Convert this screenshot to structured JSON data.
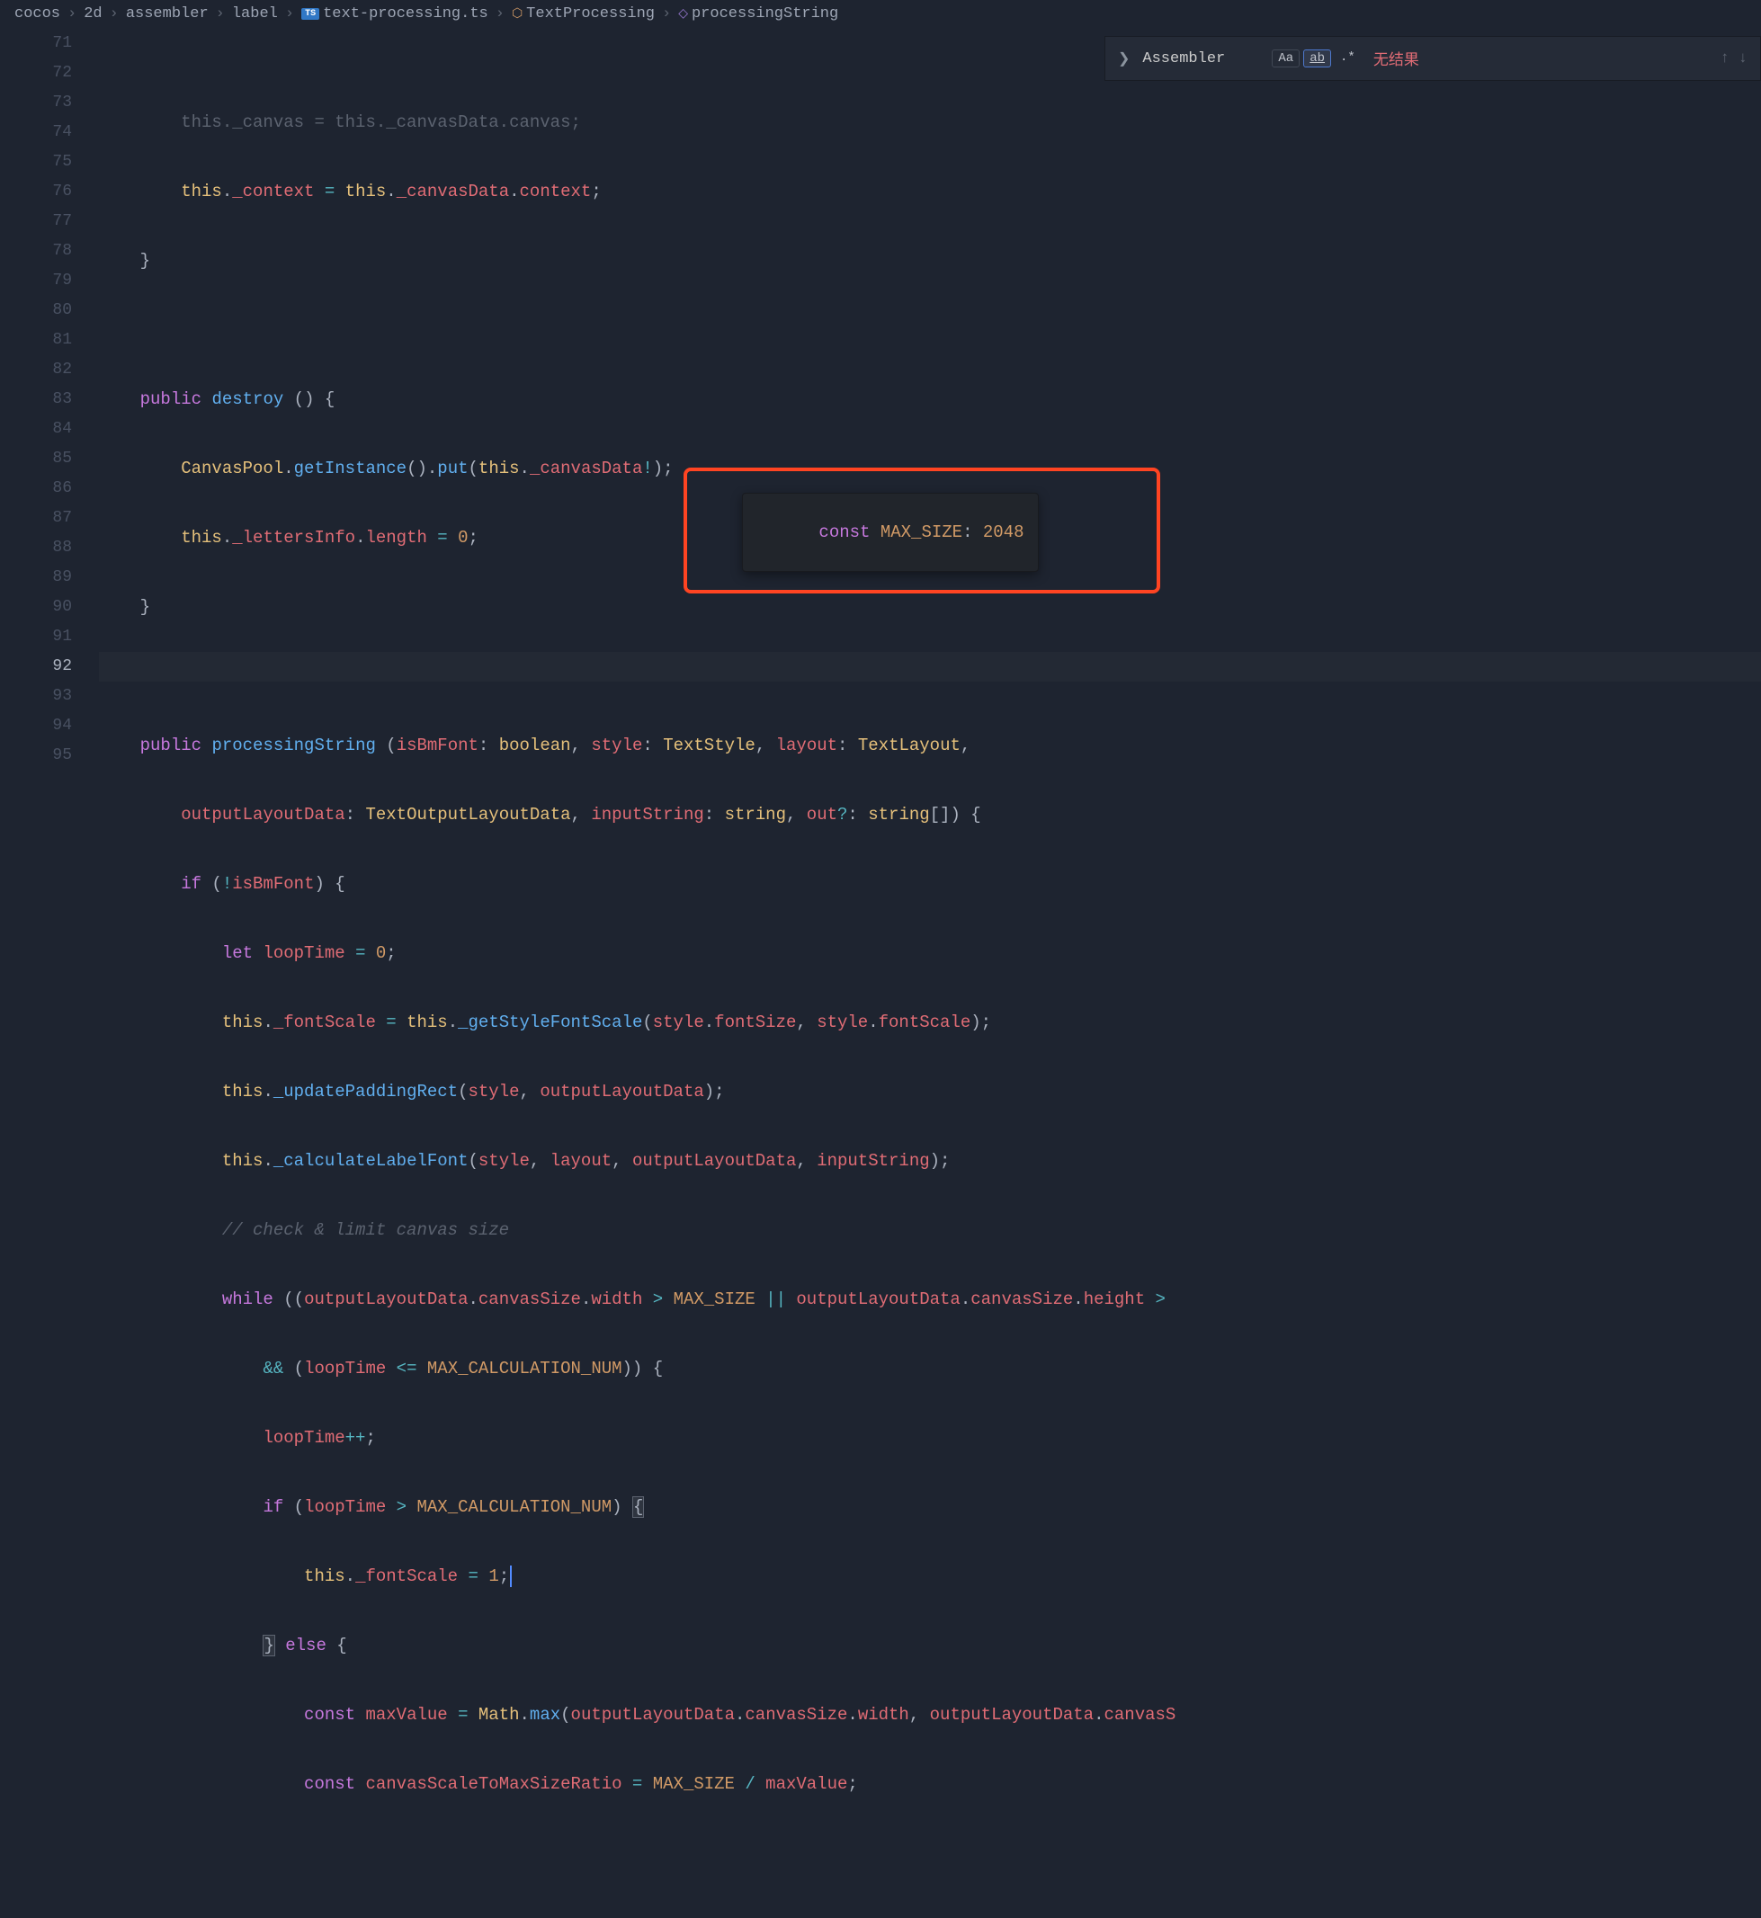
{
  "breadcrumb": {
    "parts": [
      "cocos",
      "2d",
      "assembler",
      "label",
      "text-processing.ts",
      "TextProcessing",
      "processingString"
    ]
  },
  "find": {
    "chevron": "❯",
    "text": "Assembler",
    "case_btn": "Aa",
    "word_btn": "ab",
    "regex_btn": ".*",
    "no_result": "无结果",
    "up": "↑",
    "down": "↓"
  },
  "gutter": {
    "start": 71,
    "end": 95
  },
  "tooltip": {
    "prefix": "const ",
    "name": "MAX_SIZE",
    "sep": ": ",
    "value": "2048"
  },
  "code_lines": {
    "l71": "        this._canvas = this._canvasData.canvas;",
    "l72_a": "        ",
    "l72_this": "this",
    "l72_dot1": ".",
    "l72_ctx": "_context",
    "l72_eq": " = ",
    "l72_this2": "this",
    "l72_dot2": ".",
    "l72_cd": "_canvasData",
    "l72_dot3": ".",
    "l72_c": "context",
    "l72_semi": ";",
    "l73": "    }",
    "l74": "",
    "l75_a": "    ",
    "l75_pub": "public",
    "l75_sp": " ",
    "l75_fn": "destroy",
    "l75_b": " () {",
    "l76_a": "        ",
    "l76_cp": "CanvasPool",
    "l76_d": ".",
    "l76_gi": "getInstance",
    "l76_p": "().",
    "l76_put": "put",
    "l76_op": "(",
    "l76_this": "this",
    "l76_d2": ".",
    "l76_cd": "_canvasData",
    "l76_ex": "!",
    "l76_cl": ");",
    "l77_a": "        ",
    "l77_this": "this",
    "l77_d": ".",
    "l77_li": "_lettersInfo",
    "l77_d2": ".",
    "l77_len": "length",
    "l77_eq": " = ",
    "l77_z": "0",
    "l77_s": ";",
    "l78": "    }",
    "l79": "",
    "l80_a": "    ",
    "l80_pub": "public",
    "l80_sp": " ",
    "l80_fn": "processingString",
    "l80_sp2": " (",
    "l80_p1": "isBmFont",
    "l80_c1": ": ",
    "l80_t1": "boolean",
    "l80_cm1": ", ",
    "l80_p2": "style",
    "l80_c2": ": ",
    "l80_t2": "TextStyle",
    "l80_cm2": ", ",
    "l80_p3": "layout",
    "l80_c3": ": ",
    "l80_t3": "TextLayout",
    "l80_cm3": ",",
    "l81_a": "        ",
    "l81_p1": "outputLayoutData",
    "l81_c1": ": ",
    "l81_t1": "TextOutputLayoutData",
    "l81_cm1": ", ",
    "l81_p2": "inputString",
    "l81_c2": ": ",
    "l81_t2": "string",
    "l81_cm2": ", ",
    "l81_p3": "out",
    "l81_q": "?",
    "l81_c3": ": ",
    "l81_t3": "string",
    "l81_br": "[]) {",
    "l82_a": "        ",
    "l82_if": "if",
    "l82_sp": " (",
    "l82_not": "!",
    "l82_v": "isBmFont",
    "l82_cl": ") {",
    "l83_a": "            ",
    "l83_let": "let",
    "l83_sp": " ",
    "l83_v": "loopTime",
    "l83_eq": " = ",
    "l83_z": "0",
    "l83_s": ";",
    "l84_a": "            ",
    "l84_this": "this",
    "l84_d": ".",
    "l84_fs": "_fontScale",
    "l84_eq": " = ",
    "l84_this2": "this",
    "l84_d2": ".",
    "l84_fn": "_getStyleFontScale",
    "l84_op": "(",
    "l84_v1": "style",
    "l84_d3": ".",
    "l84_p1": "fontSize",
    "l84_cm": ", ",
    "l84_v2": "style",
    "l84_d4": ".",
    "l84_p2": "fontScale",
    "l84_cl": ");",
    "l85_a": "            ",
    "l85_this": "this",
    "l85_d": ".",
    "l85_fn": "_updatePaddingRect",
    "l85_op": "(",
    "l85_v1": "style",
    "l85_cm": ", ",
    "l85_v2": "outputLayoutData",
    "l85_cl": ");",
    "l86_a": "            ",
    "l86_this": "this",
    "l86_d": ".",
    "l86_fn": "_calculateLabelFont",
    "l86_op": "(",
    "l86_v1": "style",
    "l86_cm1": ", ",
    "l86_v2": "layout",
    "l86_cm2": ", ",
    "l86_v3": "outputLayoutData",
    "l86_cm3": ", ",
    "l86_v4": "inputString",
    "l86_cl": ");",
    "l87_a": "            ",
    "l87_cmt": "// check & limit canvas size",
    "l88_a": "            ",
    "l88_wh": "while",
    "l88_sp": " ((",
    "l88_v1": "outputLayoutData",
    "l88_d1": ".",
    "l88_p1": "canvasSize",
    "l88_d2": ".",
    "l88_p2": "width",
    "l88_gt": " > ",
    "l88_c1": "MAX_SIZE",
    "l88_or": " || ",
    "l88_v2": "outputLayoutData",
    "l88_d3": ".",
    "l88_p3": "canvasSize",
    "l88_d4": ".",
    "l88_p4": "height",
    "l88_gt2": " > ",
    "l89_a": "                ",
    "l89_and": "&&",
    "l89_sp": " (",
    "l89_v": "loopTime",
    "l89_le": " <= ",
    "l89_c": "MAX_CALCULATION_NUM",
    "l89_cl": ")) {",
    "l90_a": "                ",
    "l90_v": "loopTime",
    "l90_pp": "++",
    "l90_s": ";",
    "l91_a": "                ",
    "l91_if": "if",
    "l91_sp": " (",
    "l91_v": "loopTime",
    "l91_gt": " > ",
    "l91_c": "MAX_CALCULATION_NUM",
    "l91_cl": ") ",
    "l91_br": "{",
    "l92_a": "                    ",
    "l92_this": "this",
    "l92_d": ".",
    "l92_fs": "_fontScale",
    "l92_eq": " = ",
    "l92_v": "1",
    "l92_s": ";",
    "l93_a": "                ",
    "l93_br": "}",
    "l93_sp": " ",
    "l93_else": "else",
    "l93_sp2": " {",
    "l94_a": "                    ",
    "l94_const": "const",
    "l94_sp": " ",
    "l94_v": "maxValue",
    "l94_eq": " = ",
    "l94_m": "Math",
    "l94_d": ".",
    "l94_fn": "max",
    "l94_op": "(",
    "l94_v1": "outputLayoutData",
    "l94_d1": ".",
    "l94_p1": "canvasSize",
    "l94_d2": ".",
    "l94_p2": "width",
    "l94_cm": ", ",
    "l94_v2": "outputLayoutData",
    "l94_d3": ".",
    "l94_p3": "canvasS",
    "l95_a": "                    ",
    "l95_const": "const",
    "l95_sp": " ",
    "l95_v": "canvasScaleToMaxSizeRatio",
    "l95_eq": " = ",
    "l95_c": "MAX_SIZE",
    "l95_div": " / ",
    "l95_v2": "maxValue",
    "l95_s": ";"
  }
}
